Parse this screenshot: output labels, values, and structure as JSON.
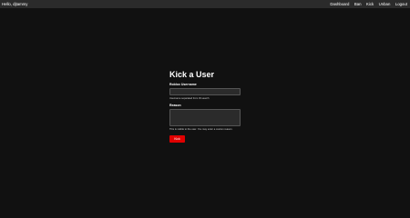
{
  "header": {
    "greeting": "Hello, djtammy",
    "nav": [
      "Dashboard",
      "Ban",
      "Kick",
      "Unban",
      "Logout"
    ]
  },
  "form": {
    "title": "Kick a User",
    "username_label": "Roblox Username",
    "username_value": "",
    "username_help": "Username separated from ID search",
    "reason_label": "Reason",
    "reason_value": "",
    "reason_help": "This is visible to the user. You may enter a custom reason.",
    "submit_label": "Kick"
  },
  "colors": {
    "background": "#111111",
    "topbar": "#2b2b2b",
    "field": "#2b2b2b",
    "button": "#e00000"
  }
}
